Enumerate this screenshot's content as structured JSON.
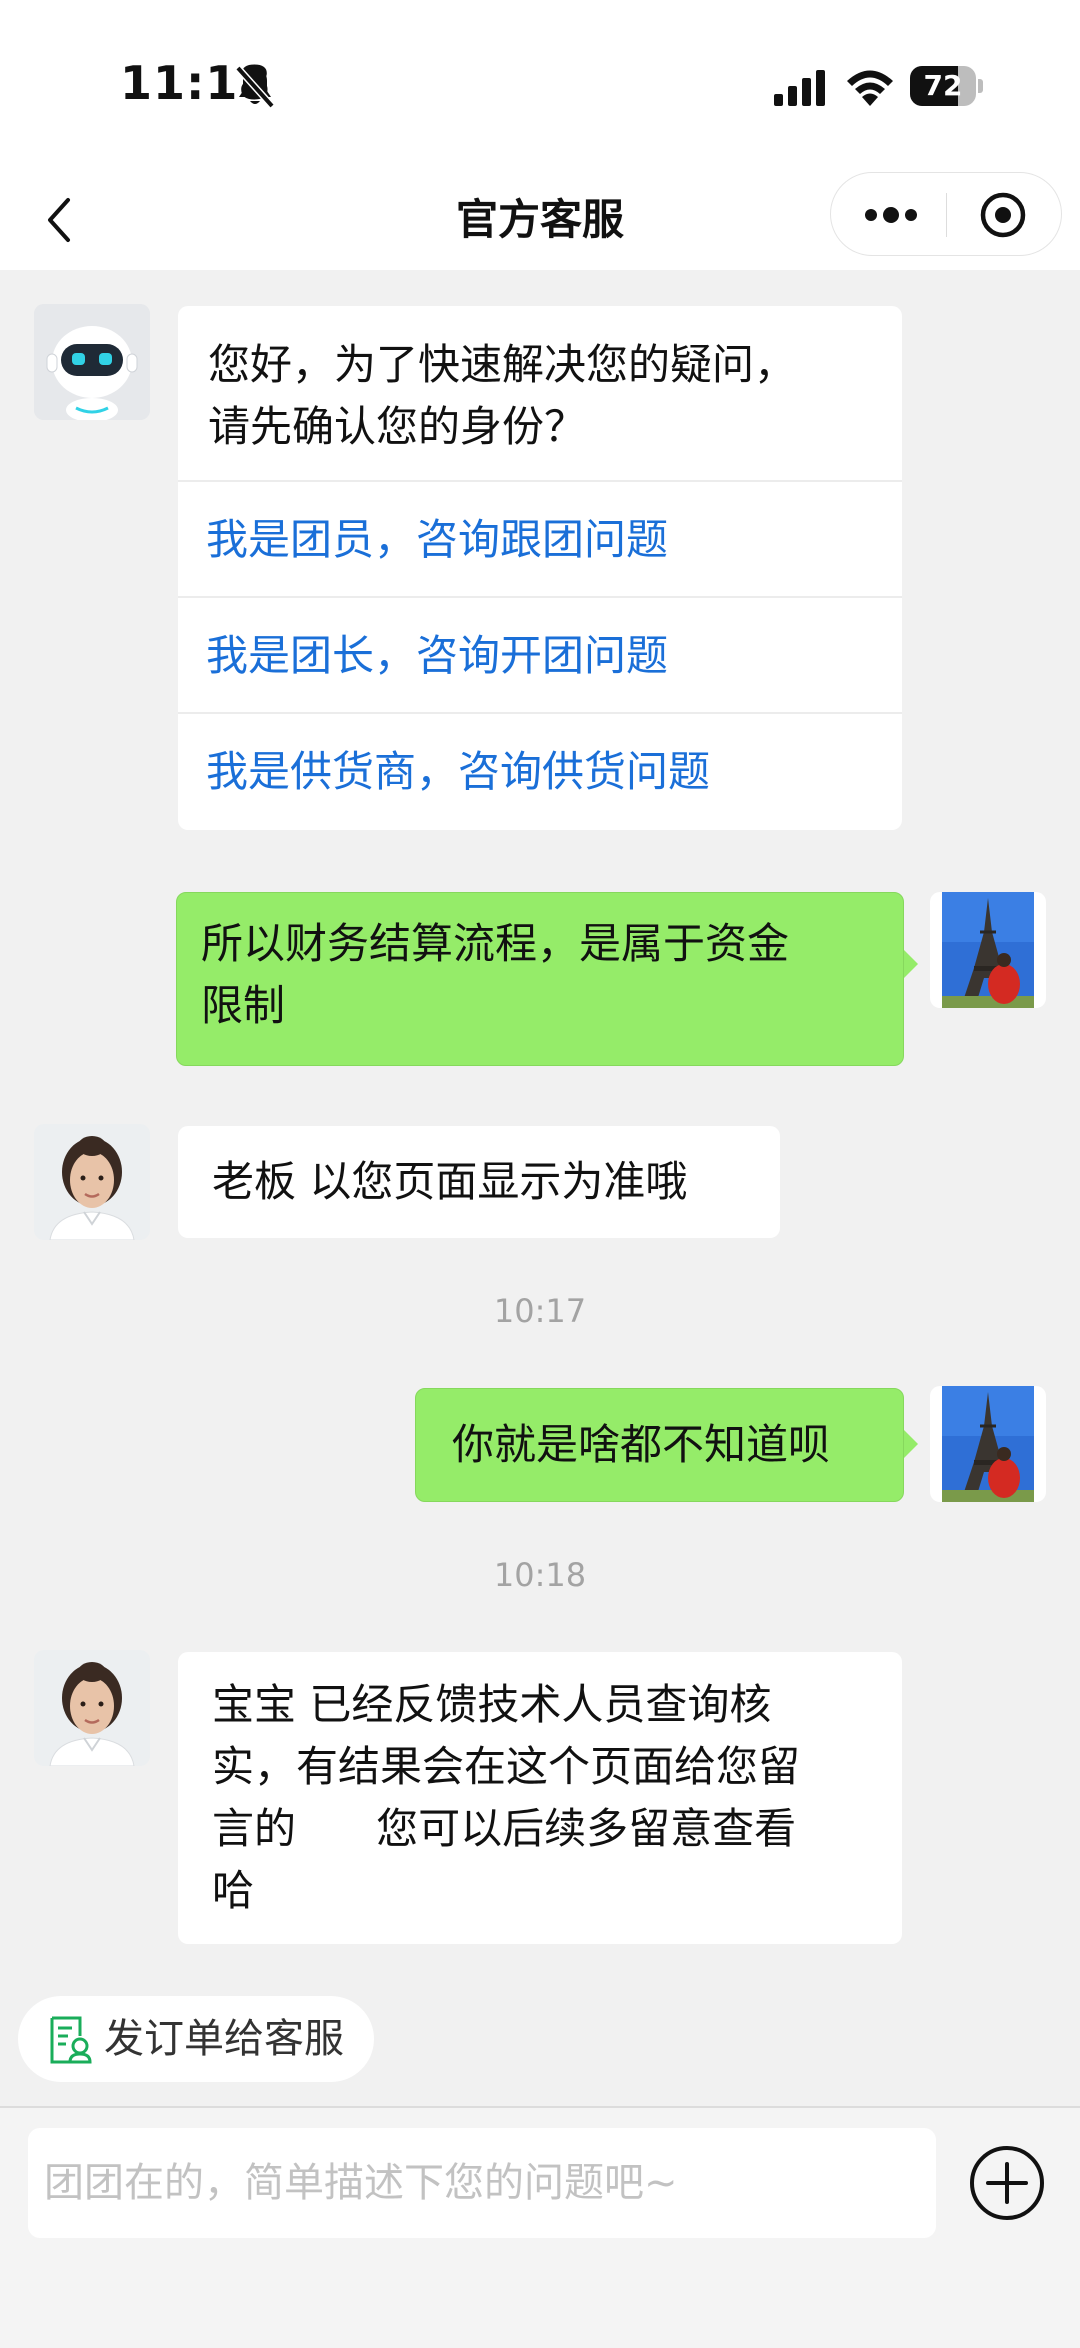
{
  "status_bar": {
    "time": "11:18",
    "battery_level": "72",
    "battery_fraction": 0.72,
    "icons": [
      "bell-muted-icon",
      "signal-icon",
      "wifi-icon",
      "battery-icon"
    ]
  },
  "nav": {
    "title": "官方客服",
    "icons": [
      "back-icon",
      "more-icon",
      "mini-program-close-icon"
    ]
  },
  "colors": {
    "outgoing_bubble": "#95ec69",
    "link_blue": "#1a6fd8",
    "background": "#f1f1f1",
    "order_icon_green": "#1aad5a"
  },
  "messages": {
    "bot_menu": {
      "greeting_line1": "您好，为了快速解决您的疑问，",
      "greeting_line2": "请先确认您的身份？",
      "options": [
        "我是团员，咨询跟团问题",
        "我是团长，咨询开团问题",
        "我是供货商，咨询供货问题"
      ]
    },
    "out_1_line1": "所以财务结算流程，是属于资金",
    "out_1_line2": "限制",
    "in_1": "老板  以您页面显示为准哦",
    "time_1": "10:17",
    "out_2": "你就是啥都不知道呗",
    "time_2": "10:18",
    "in_2_line1": "宝宝  已经反馈技术人员查询核",
    "in_2_line2": "实，有结果会在这个页面给您留",
    "in_2_line3": "言的      您可以后续多留意查看",
    "in_2_line4": "哈"
  },
  "order_chip": {
    "label": "发订单给客服",
    "icon": "order-document-icon"
  },
  "input": {
    "placeholder": "团团在的，简单描述下您的问题吧~",
    "value": "",
    "icon": "plus-icon"
  }
}
